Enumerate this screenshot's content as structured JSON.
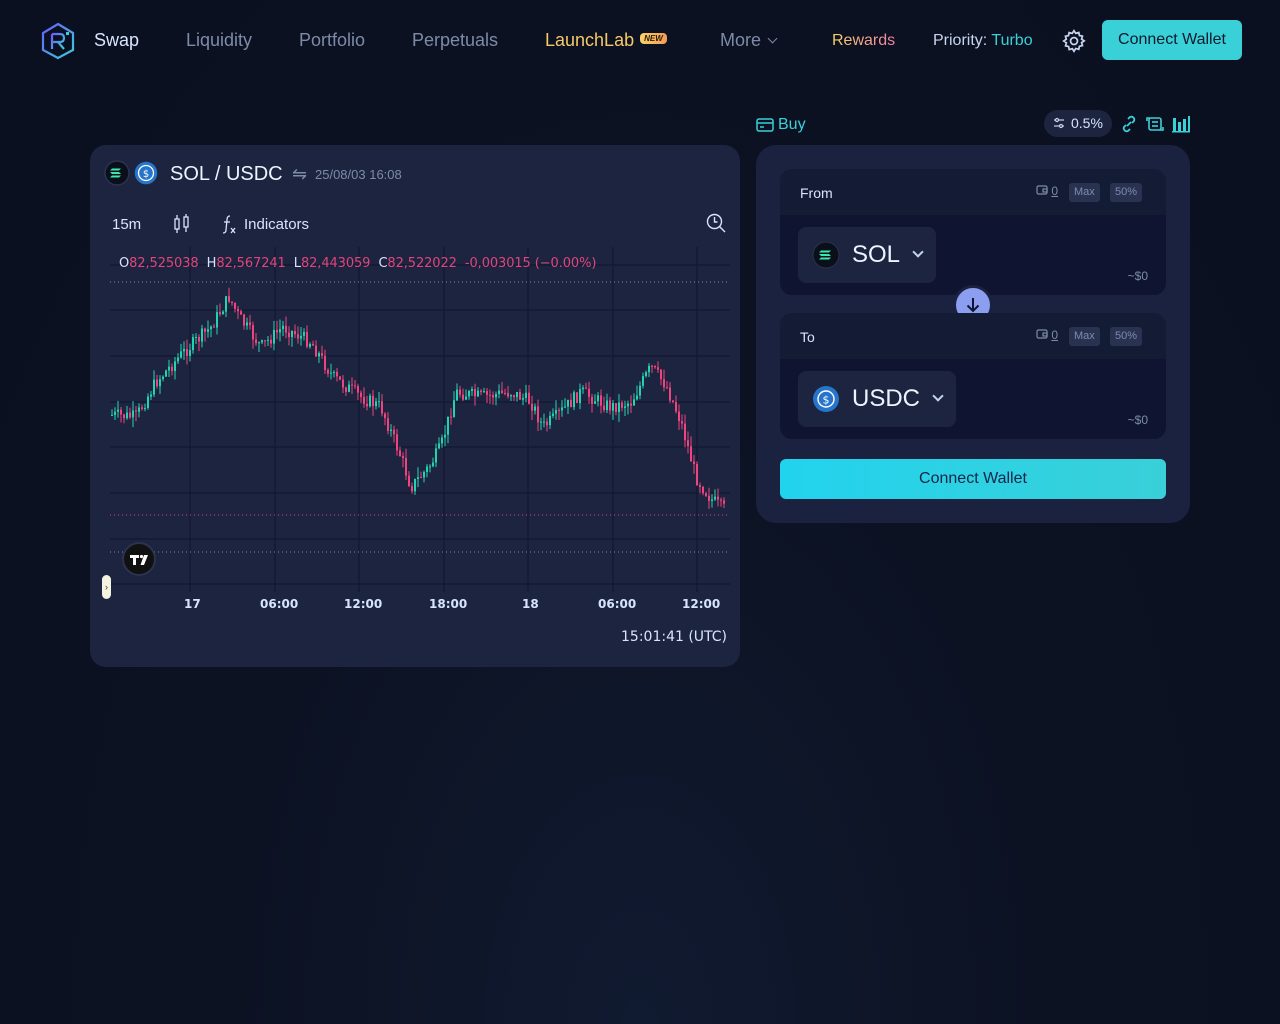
{
  "nav": {
    "items": [
      "Swap",
      "Liquidity",
      "Portfolio",
      "Perpetuals"
    ],
    "launchlab": "LaunchLab",
    "new_badge": "NEW",
    "more": "More",
    "rewards": "Rewards",
    "priority_label": "Priority:",
    "priority_value": "Turbo",
    "connect_wallet": "Connect Wallet"
  },
  "chart": {
    "pair": "SOL / USDC",
    "timestamp": "25/08/03 16:08",
    "interval": "15m",
    "indicators_label": "Indicators",
    "ohlc": {
      "o_label": "O",
      "o": "82,525038",
      "h_label": "H",
      "h": "82,567241",
      "l_label": "L",
      "l": "82,443059",
      "c_label": "C",
      "c": "82,522022",
      "change": "-0,003015 (−0.00%)"
    },
    "x_labels": [
      "17",
      "06:00",
      "12:00",
      "18:00",
      "18",
      "06:00",
      "12:00"
    ],
    "clock": "15:01:41 (UTC)",
    "up_color": "#22d3b0",
    "down_color": "#f0447e"
  },
  "swap": {
    "buy_label": "Buy",
    "slippage": "0.5%",
    "from": {
      "label": "From",
      "balance": "0",
      "max": "Max",
      "half": "50%",
      "token": "SOL",
      "usd": "~$0"
    },
    "to": {
      "label": "To",
      "balance": "0",
      "max": "Max",
      "half": "50%",
      "token": "USDC",
      "usd": "~$0"
    },
    "connect_wallet": "Connect Wallet"
  },
  "icons": [
    "raydium-logo-icon",
    "gear-icon",
    "chevron-down-icon",
    "sol-icon",
    "usdc-icon",
    "swap-arrows-icon",
    "candle-type-icon",
    "fx-icon",
    "crosshair-search-icon",
    "tradingview-logo-icon",
    "card-icon",
    "sliders-icon",
    "link-icon",
    "refresh-icon",
    "bar-chart-icon",
    "wallet-icon",
    "arrow-down-icon"
  ],
  "colors": {
    "accent": "#39d0d8",
    "panel": "#1c2440",
    "bg": "#0b1020"
  }
}
